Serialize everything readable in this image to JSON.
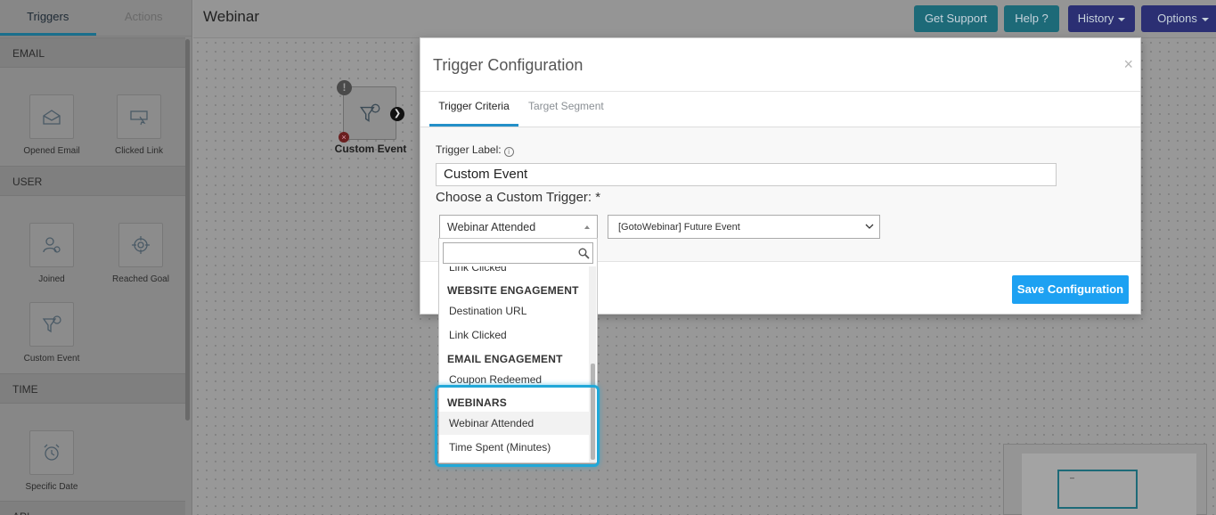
{
  "sidebar": {
    "tabs": [
      {
        "label": "Triggers",
        "active": true
      },
      {
        "label": "Actions",
        "active": false
      }
    ],
    "sections": {
      "email": {
        "title": "EMAIL",
        "items": [
          {
            "label": "Opened Email",
            "icon": "opened-email-icon"
          },
          {
            "label": "Clicked Link",
            "icon": "clicked-link-icon"
          }
        ]
      },
      "user": {
        "title": "USER",
        "items": [
          {
            "label": "Joined",
            "icon": "joined-icon"
          },
          {
            "label": "Reached Goal",
            "icon": "target-icon"
          },
          {
            "label": "Custom Event",
            "icon": "funnel-icon"
          }
        ]
      },
      "time": {
        "title": "TIME",
        "items": [
          {
            "label": "Specific Date",
            "icon": "alarm-clock-icon"
          }
        ]
      },
      "api": {
        "title": "API"
      }
    }
  },
  "header": {
    "title": "Webinar",
    "buttons": {
      "support": "Get Support",
      "help": "Help ?",
      "history": "History",
      "options": "Options"
    }
  },
  "canvas": {
    "node": {
      "label": "Custom Event",
      "icon": "funnel-icon"
    },
    "minimap_marker": "–"
  },
  "modal": {
    "title": "Trigger Configuration",
    "close": "×",
    "tabs": [
      "Trigger Criteria",
      "Target Segment"
    ],
    "trigger_label_text": "Trigger Label:",
    "info": "i",
    "trigger_label_value": "Custom Event",
    "choose_label": "Choose a Custom Trigger: *",
    "selected_trigger": "Webinar Attended",
    "selected_event": "[GotoWebinar] Future Event",
    "save_label": "Save Configuration"
  },
  "dropdown": {
    "partial_item": "Link Clicked",
    "groups": [
      {
        "title": "WEBSITE ENGAGEMENT",
        "items": [
          "Destination URL",
          "Link Clicked"
        ]
      },
      {
        "title": "EMAIL ENGAGEMENT",
        "items": [
          "Coupon Redeemed"
        ]
      },
      {
        "title": "WEBINARS",
        "items": [
          "Webinar Attended",
          "Time Spent (Minutes)"
        ]
      }
    ]
  },
  "colors": {
    "accent": "#1da1f2",
    "highlight": "#21a8d8",
    "teal_button": "#1d6a78",
    "navy_button": "#2b2f73"
  }
}
